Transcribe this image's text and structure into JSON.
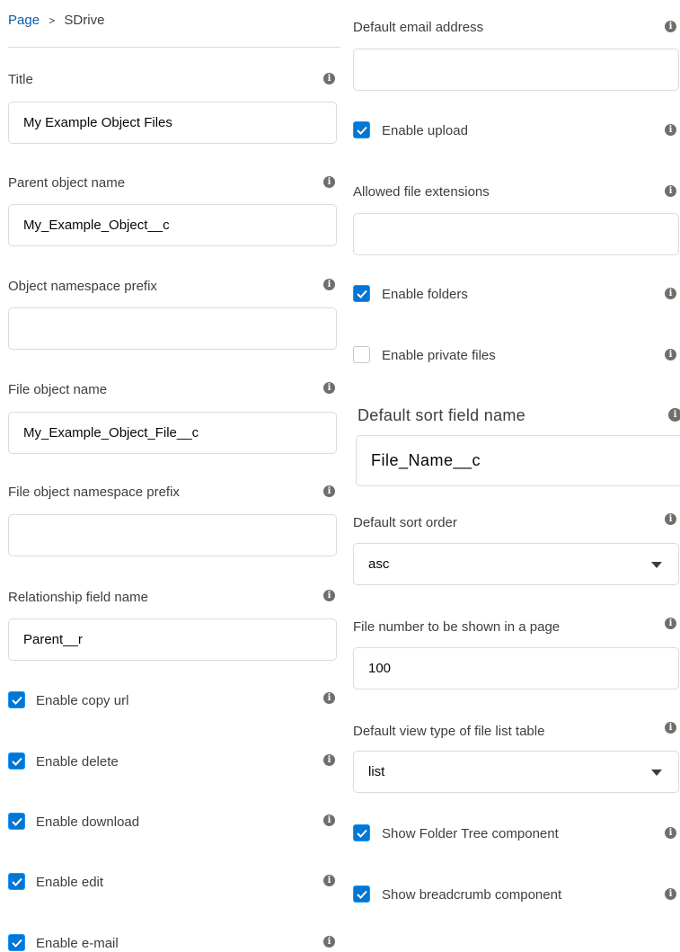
{
  "breadcrumb": {
    "page": "Page",
    "separator": ">",
    "current": "SDrive"
  },
  "left": {
    "title": {
      "label": "Title",
      "value": "My Example Object Files"
    },
    "parent_object_name": {
      "label": "Parent object name",
      "value": "My_Example_Object__c"
    },
    "object_namespace_prefix": {
      "label": "Object namespace prefix",
      "value": ""
    },
    "file_object_name": {
      "label": "File object name",
      "value": "My_Example_Object_File__c"
    },
    "file_object_namespace_prefix": {
      "label": "File object namespace prefix",
      "value": ""
    },
    "relationship_field_name": {
      "label": "Relationship field name",
      "value": "Parent__r"
    },
    "enable_copy_url": {
      "label": "Enable copy url",
      "checked": true
    },
    "enable_delete": {
      "label": "Enable delete",
      "checked": true
    },
    "enable_download": {
      "label": "Enable download",
      "checked": true
    },
    "enable_edit": {
      "label": "Enable edit",
      "checked": true
    },
    "enable_email": {
      "label": "Enable e-mail",
      "checked": true
    }
  },
  "right": {
    "default_email_address": {
      "label": "Default email address",
      "value": ""
    },
    "enable_upload": {
      "label": "Enable upload",
      "checked": true
    },
    "allowed_file_extensions": {
      "label": "Allowed file extensions",
      "value": ""
    },
    "enable_folders": {
      "label": "Enable folders",
      "checked": true
    },
    "enable_private_files": {
      "label": "Enable private files",
      "checked": false
    },
    "default_sort_field_name": {
      "label": "Default sort field name",
      "value": "File_Name__c"
    },
    "default_sort_order": {
      "label": "Default sort order",
      "value": "asc"
    },
    "file_number_per_page": {
      "label": "File number to be shown in a page",
      "value": "100"
    },
    "default_view_type": {
      "label": "Default view type of file list table",
      "value": "list"
    },
    "show_folder_tree": {
      "label": "Show Folder Tree component",
      "checked": true
    },
    "show_breadcrumb": {
      "label": "Show breadcrumb component",
      "checked": true
    }
  },
  "icons": {
    "info": "info-icon",
    "check": "check-icon",
    "chevron": "chevron-down-icon"
  },
  "colors": {
    "accent": "#0176d3",
    "link": "#0b5cab",
    "border": "#dddbda"
  }
}
